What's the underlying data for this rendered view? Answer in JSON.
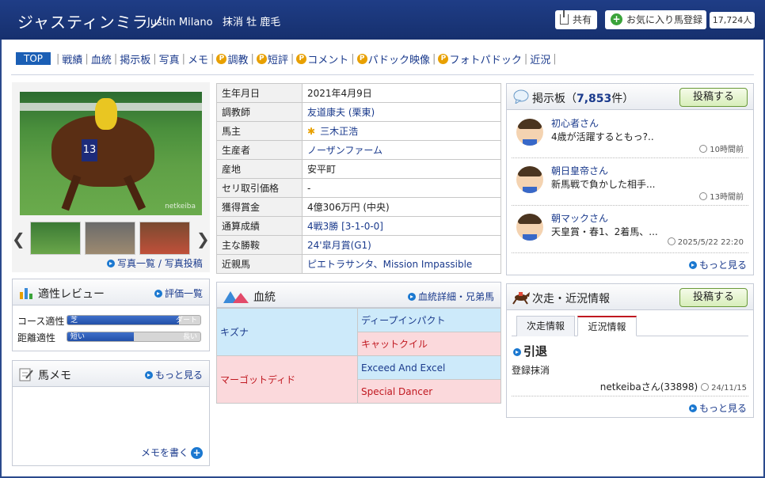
{
  "header": {
    "name_ja": "ジャスティンミラノ",
    "name_en": "Justin Milano",
    "status": "抹消 牡 鹿毛",
    "share_label": "共有",
    "fav_label": "お気に入り馬登録",
    "fav_count": "17,724人"
  },
  "nav": {
    "top": "TOP",
    "items": [
      "戦績",
      "血統",
      "掲示板",
      "写真",
      "メモ",
      "調教",
      "短評",
      "コメント",
      "パドック映像",
      "フォトパドック",
      "近況"
    ]
  },
  "photo": {
    "watermark": "netkeiba",
    "saddle_number": "13",
    "list_link": "写真一覧",
    "post_link": "写真投稿"
  },
  "profile": {
    "rows": [
      {
        "key": "生年月日",
        "value": "2021年4月9日"
      },
      {
        "key": "調教師",
        "value": "友道康夫 (栗東)"
      },
      {
        "key": "馬主",
        "value": "三木正浩"
      },
      {
        "key": "生産者",
        "value": "ノーザンファーム"
      },
      {
        "key": "産地",
        "value": "安平町"
      },
      {
        "key": "セリ取引価格",
        "value": "-"
      },
      {
        "key": "獲得賞金",
        "value": "4億306万円 (中央)"
      },
      {
        "key": "通算成績",
        "value": "4戦3勝 [3-1-0-0]"
      },
      {
        "key": "主な勝鞍",
        "value": "24'皐月賞(G1)"
      },
      {
        "key": "近親馬",
        "value": "ピエトラサンタ、Mission Impassible"
      }
    ]
  },
  "aptitude": {
    "title": "適性レビュー",
    "link": "評価一覧",
    "course": {
      "label": "コース適性",
      "left": "芝",
      "right": "ダート",
      "level": 0.84
    },
    "distance": {
      "label": "距離適性",
      "left": "短い",
      "right": "長い",
      "level": 0.5
    }
  },
  "memo": {
    "title": "馬メモ",
    "link": "もっと見る",
    "write": "メモを書く"
  },
  "pedigree": {
    "title": "血統",
    "link": "血統詳細・兄弟馬",
    "sire": "キズナ",
    "sire_sire": "ディープインパクト",
    "sire_dam": "キャットクイル",
    "dam": "マーゴットディド",
    "dam_sire": "Exceed And Excel",
    "dam_dam": "Special Dancer"
  },
  "board": {
    "title": "掲示板",
    "count": "7,853",
    "count_unit": "件",
    "post_label": "投稿する",
    "more": "もっと見る",
    "posts": [
      {
        "user": "初心者さん",
        "text": "4歳が活躍するともっ?..",
        "time": "10時間前"
      },
      {
        "user": "朝日皇帝さん",
        "text": "新馬戦で負かした相手...",
        "time": "13時間前"
      },
      {
        "user": "朝マックさん",
        "text": "天皇賞・春1、2着馬、...",
        "time": "2025/5/22 22:20"
      }
    ]
  },
  "next_race": {
    "title": "次走・近況情報",
    "post_label": "投稿する",
    "tabs": [
      "次走情報",
      "近況情報"
    ],
    "status": "引退",
    "note": "登録抹消",
    "author": "netkeibaさん(33898)",
    "date": "24/11/15",
    "more": "もっと見る"
  },
  "colors": {
    "header_bg": "#1f3d86",
    "link": "#1a3a8c",
    "sire_bg": "#cdeafa",
    "dam_bg": "#fbd9dc"
  }
}
